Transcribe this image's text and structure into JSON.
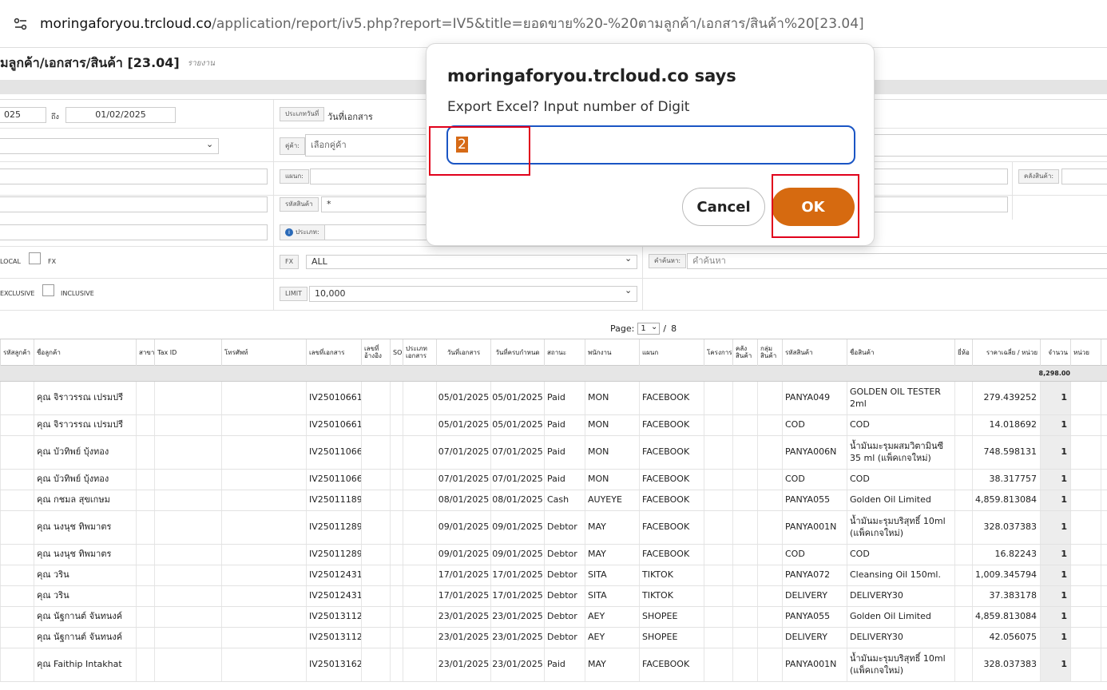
{
  "browser": {
    "url_host": "moringaforyou.trcloud.co",
    "url_path": "/application/report/iv5.php?report=IV5&title=ยอดขาย%20-%20ตามลูกค้า/เอกสาร/สินค้า%20[23.04]"
  },
  "page": {
    "title": "มลูกค้า/เอกสาร/สินค้า [23.04]",
    "subtitle": "รายงาน"
  },
  "filters": {
    "date_from": "025",
    "to_label": "ถึง",
    "date_to": "01/02/2025",
    "date_type_label": "ประเภทวันที่",
    "date_type_value": "วันที่เอกสาร",
    "partner_label": "คู่ค้า:",
    "partner_placeholder": "เลือกคู่ค้า",
    "dept_label": "แผนก:",
    "warehouse_label": "คลังสินค้า:",
    "product_code_label": "รหัสสินค้า",
    "product_code_value": "*",
    "type_label": "ประเภท:",
    "local_label": "LOCAL",
    "fx_check_label": "FX",
    "fx_label": "FX",
    "fx_value": "ALL",
    "search_label": "คำค้นหา:",
    "search_placeholder": "คำค้นหา",
    "exclusive_label": "EXCLUSIVE",
    "inclusive_label": "INCLUSIVE",
    "limit_label": "LIMIT",
    "limit_value": "10,000"
  },
  "pager": {
    "label": "Page:",
    "current": "1",
    "separator": "/",
    "total": "8"
  },
  "table": {
    "headers": {
      "customer_code": "รหัสลูกค้า",
      "customer_name": "ชื่อลูกค้า",
      "branch": "สาขา",
      "tax_id": "Tax ID",
      "phone": "โทรศัพท์",
      "doc_no": "เลขที่เอกสาร",
      "ref_no": "เลขที่ อ้างอิง",
      "so": "SO",
      "doc_type": "ประเภท เอกสาร",
      "doc_date": "วันที่เอกสาร",
      "due_date": "วันที่ครบกำหนด",
      "status": "สถานะ",
      "employee": "พนักงาน",
      "department": "แผนก",
      "project": "โครงการ",
      "warehouse": "คลัง สินค้า",
      "product_group": "กลุ่ม สินค้า",
      "product_code": "รหัสสินค้า",
      "product_name": "ชื่อสินค้า",
      "brand": "ยี่ห้อ",
      "avg_price": "ราคาเฉลี่ย / หน่วย",
      "qty": "จำนวน",
      "unit": "หน่วย"
    },
    "total_qty": "8,298.00",
    "rows": [
      {
        "name": "คุณ จิราวรรณ เปรมปรี",
        "doc": "IV25010661",
        "date": "05/01/2025",
        "due": "05/01/2025",
        "status": "Paid",
        "emp": "MON",
        "dept": "FACEBOOK",
        "code": "PANYA049",
        "product": "GOLDEN OIL TESTER 2ml",
        "price": "279.439252",
        "qty": "1"
      },
      {
        "name": "คุณ จิราวรรณ เปรมปรี",
        "doc": "IV25010661",
        "date": "05/01/2025",
        "due": "05/01/2025",
        "status": "Paid",
        "emp": "MON",
        "dept": "FACEBOOK",
        "code": "COD",
        "product": "COD",
        "price": "14.018692",
        "qty": "1"
      },
      {
        "name": "คุณ บัวทิพย์ บุ้งทอง",
        "doc": "IV25011066",
        "date": "07/01/2025",
        "due": "07/01/2025",
        "status": "Paid",
        "emp": "MON",
        "dept": "FACEBOOK",
        "code": "PANYA006N",
        "product": "น้ำมันมะรุมผสมวิตามินซี 35 ml (แพ็คเกจใหม่)",
        "price": "748.598131",
        "qty": "1"
      },
      {
        "name": "คุณ บัวทิพย์ บุ้งทอง",
        "doc": "IV25011066",
        "date": "07/01/2025",
        "due": "07/01/2025",
        "status": "Paid",
        "emp": "MON",
        "dept": "FACEBOOK",
        "code": "COD",
        "product": "COD",
        "price": "38.317757",
        "qty": "1"
      },
      {
        "name": "คุณ กชมล สุขเกษม",
        "doc": "IV25011189",
        "date": "08/01/2025",
        "due": "08/01/2025",
        "status": "Cash",
        "emp": "AUYEYE",
        "dept": "FACEBOOK",
        "code": "PANYA055",
        "product": "Golden Oil Limited",
        "price": "4,859.813084",
        "qty": "1"
      },
      {
        "name": "คุณ นงนุช ทิพมาตร",
        "doc": "IV25011289",
        "date": "09/01/2025",
        "due": "09/01/2025",
        "status": "Debtor",
        "emp": "MAY",
        "dept": "FACEBOOK",
        "code": "PANYA001N",
        "product": "น้ำมันมะรุมบริสุทธิ์ 10ml (แพ็คเกจใหม่)",
        "price": "328.037383",
        "qty": "1"
      },
      {
        "name": "คุณ นงนุช ทิพมาตร",
        "doc": "IV25011289",
        "date": "09/01/2025",
        "due": "09/01/2025",
        "status": "Debtor",
        "emp": "MAY",
        "dept": "FACEBOOK",
        "code": "COD",
        "product": "COD",
        "price": "16.82243",
        "qty": "1"
      },
      {
        "name": "คุณ วริน",
        "doc": "IV25012431",
        "date": "17/01/2025",
        "due": "17/01/2025",
        "status": "Debtor",
        "emp": "SITA",
        "dept": "TIKTOK",
        "code": "PANYA072",
        "product": "Cleansing Oil 150ml.",
        "price": "1,009.345794",
        "qty": "1"
      },
      {
        "name": "คุณ วริน",
        "doc": "IV25012431",
        "date": "17/01/2025",
        "due": "17/01/2025",
        "status": "Debtor",
        "emp": "SITA",
        "dept": "TIKTOK",
        "code": "DELIVERY",
        "product": "DELIVERY30",
        "price": "37.383178",
        "qty": "1"
      },
      {
        "name": "คุณ นัฐกานต์ จันทนงค์",
        "doc": "IV25013112",
        "date": "23/01/2025",
        "due": "23/01/2025",
        "status": "Debtor",
        "emp": "AEY",
        "dept": "SHOPEE",
        "code": "PANYA055",
        "product": "Golden Oil Limited",
        "price": "4,859.813084",
        "qty": "1"
      },
      {
        "name": "คุณ นัฐกานต์ จันทนงค์",
        "doc": "IV25013112",
        "date": "23/01/2025",
        "due": "23/01/2025",
        "status": "Debtor",
        "emp": "AEY",
        "dept": "SHOPEE",
        "code": "DELIVERY",
        "product": "DELIVERY30",
        "price": "42.056075",
        "qty": "1"
      },
      {
        "name": "คุณ Faithip Intakhat",
        "doc": "IV25013162",
        "date": "23/01/2025",
        "due": "23/01/2025",
        "status": "Paid",
        "emp": "MAY",
        "dept": "FACEBOOK",
        "code": "PANYA001N",
        "product": "น้ำมันมะรุมบริสุทธิ์ 10ml (แพ็คเกจใหม่)",
        "price": "328.037383",
        "qty": "1"
      }
    ]
  },
  "dialog": {
    "title": "moringaforyou.trcloud.co says",
    "message": "Export Excel? Input number of Digit",
    "input_value": "2",
    "cancel_label": "Cancel",
    "ok_label": "OK",
    "accent_color": "#d66a10",
    "highlight_color": "#e0001b"
  }
}
